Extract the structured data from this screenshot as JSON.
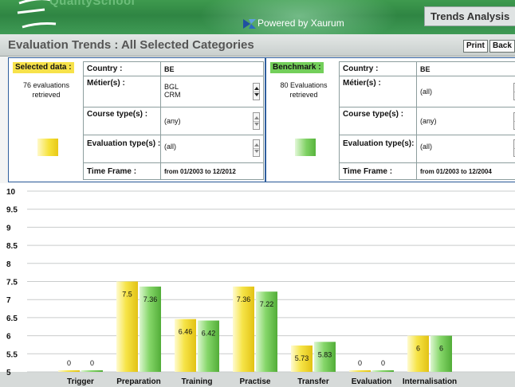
{
  "header": {
    "logo_text": "QualitySchool",
    "powered_by": "Powered by Xaurum",
    "app_title": "Trends Analysis"
  },
  "toolbar": {
    "page_title": "Evaluation Trends : All Selected Categories",
    "print_label": "Print",
    "back_label": "Back"
  },
  "selected": {
    "tag": "Selected data :",
    "count_line1": "76 evaluations",
    "count_line2": "retrieved",
    "swatch_color": "#f6e23a",
    "rows": [
      {
        "label": "Country :",
        "values": [
          "BE"
        ]
      },
      {
        "label": "Métier(s) :",
        "values": [
          "BGL",
          "CRM"
        ]
      },
      {
        "label": "Course type(s) :",
        "values": [
          "(any)"
        ]
      },
      {
        "label": "Evaluation type(s) :",
        "values": [
          "(all)"
        ]
      },
      {
        "label": "Time Frame :",
        "values": [
          "from 01/2003 to 12/2012"
        ]
      }
    ]
  },
  "benchmark": {
    "tag": "Benchmark :",
    "count_line1": "80 Evaluations",
    "count_line2": "retrieved",
    "swatch_color": "#7fd163",
    "rows": [
      {
        "label": "Country :",
        "values": [
          "BE"
        ]
      },
      {
        "label": "Métier(s) :",
        "values": [
          "(all)"
        ]
      },
      {
        "label": "Course type(s) :",
        "values": [
          "(any)"
        ]
      },
      {
        "label": "Evaluation type(s):",
        "values": [
          "(all)"
        ]
      },
      {
        "label": "Time Frame :",
        "values": [
          "from 01/2003 to 12/2004"
        ]
      }
    ]
  },
  "colors": {
    "selected_bar": "#f5e13c",
    "benchmark_bar": "#79cf5e",
    "brand_green": "#2f8543",
    "panel_border": "#2f5e9d"
  },
  "chart_data": {
    "type": "bar",
    "categories": [
      "Trigger",
      "Preparation",
      "Training",
      "Practise",
      "Transfer",
      "Evaluation",
      "Internalisation"
    ],
    "series": [
      {
        "values": [
          0,
          7.5,
          6.46,
          7.36,
          5.73,
          0,
          6
        ]
      },
      {
        "values": [
          0,
          7.36,
          6.42,
          7.22,
          5.83,
          0,
          6
        ]
      }
    ],
    "data_labels": [
      [
        "0",
        "7.5",
        "6.46",
        "7.36",
        "5.73",
        "0",
        "6"
      ],
      [
        "0",
        "7.36",
        "6.42",
        "7.22",
        "5.83",
        "0",
        "6"
      ]
    ],
    "y_ticks": [
      "10",
      "9.5",
      "9",
      "8.5",
      "8",
      "7.5",
      "7",
      "6.5",
      "6",
      "5.5",
      "5"
    ],
    "ylim": [
      5,
      10
    ],
    "grid": true
  }
}
